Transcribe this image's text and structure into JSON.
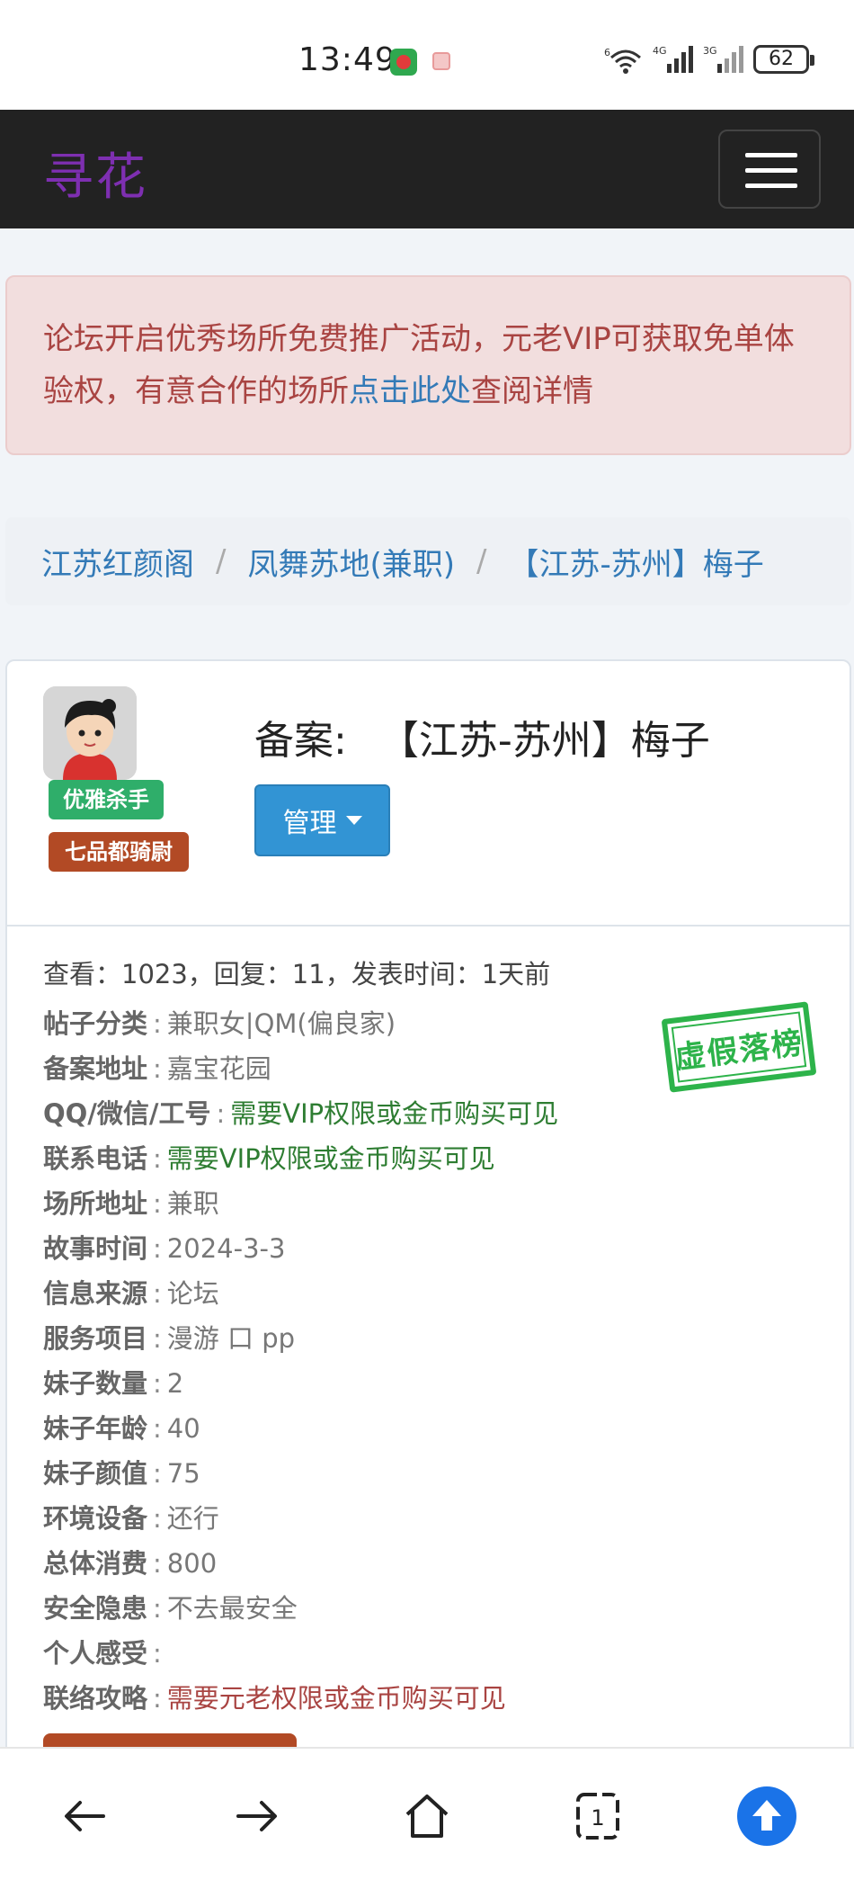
{
  "status_bar": {
    "time": "13:49",
    "network1": "6",
    "network2": "4G",
    "network3": "3G",
    "battery": "62"
  },
  "navbar": {
    "brand": "寻花",
    "colors": {
      "background": "#222222",
      "brand": "#7e2fb1"
    }
  },
  "alert": {
    "text_before": "论坛开启优秀场所免费推广活动，元老VIP可获取免单体验权，有意合作的场所",
    "link": "点击此处",
    "text_after": "查阅详情"
  },
  "breadcrumb": {
    "items": [
      "江苏红颜阁",
      "凤舞苏地(兼职)",
      "【江苏-苏州】梅子"
    ],
    "separator": "/"
  },
  "post": {
    "badges": [
      "优雅杀手",
      "七品都骑尉"
    ],
    "title_label": "备案:",
    "title": "【江苏-苏州】梅子",
    "manage_label": "管理",
    "stats": "查看：1023，回复：11，发表时间：1天前",
    "stamp": "虚假落榜",
    "fields": [
      {
        "key": "帖子分类",
        "value": "兼职女|QM(偏良家)",
        "style": ""
      },
      {
        "key": "备案地址",
        "value": "嘉宝花园",
        "style": ""
      },
      {
        "key": "QQ/微信/工号",
        "value": "需要VIP权限或金币购买可见",
        "style": "green"
      },
      {
        "key": "联系电话",
        "value": "需要VIP权限或金币购买可见",
        "style": "green"
      },
      {
        "key": "场所地址",
        "value": "兼职",
        "style": ""
      },
      {
        "key": "故事时间",
        "value": "2024-3-3",
        "style": ""
      },
      {
        "key": "信息来源",
        "value": "论坛",
        "style": ""
      },
      {
        "key": "服务项目",
        "value": "漫游 口 pp",
        "style": ""
      },
      {
        "key": "妹子数量",
        "value": "2",
        "style": ""
      },
      {
        "key": "妹子年龄",
        "value": "40",
        "style": ""
      },
      {
        "key": "妹子颜值",
        "value": "75",
        "style": ""
      },
      {
        "key": "环境设备",
        "value": "还行",
        "style": ""
      },
      {
        "key": "总体消费",
        "value": "800",
        "style": ""
      },
      {
        "key": "安全隐患",
        "value": "不去最安全",
        "style": ""
      },
      {
        "key": "个人感受",
        "value": "",
        "style": ""
      },
      {
        "key": "联络攻略",
        "value": "需要元老权限或金币购买可见",
        "style": "red"
      }
    ]
  },
  "bottom_nav": {
    "icons": [
      "back-arrow-icon",
      "forward-arrow-icon",
      "home-icon",
      "tabs-icon",
      "scroll-top-icon"
    ],
    "tab_count": "1",
    "colors": {
      "accent": "#1a73e8"
    }
  }
}
